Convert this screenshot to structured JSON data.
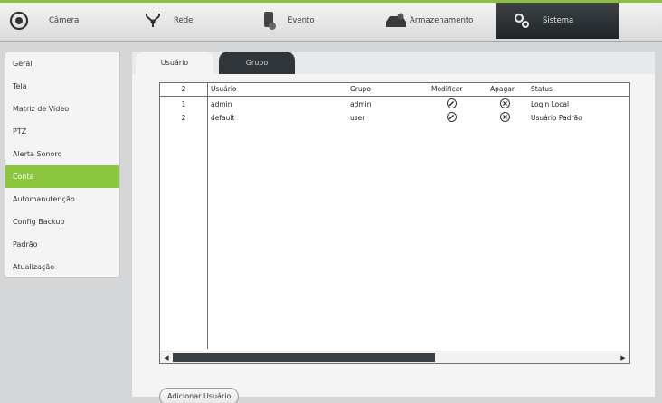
{
  "topnav": {
    "camera": "Câmera",
    "rede": "Rede",
    "evento": "Evento",
    "armazenamento": "Armazenamento",
    "sistema": "Sistema"
  },
  "sidebar": {
    "items": [
      {
        "label": "Geral"
      },
      {
        "label": "Tela"
      },
      {
        "label": "Matriz de Video"
      },
      {
        "label": "PTZ"
      },
      {
        "label": "Alerta Sonoro"
      },
      {
        "label": "Conta"
      },
      {
        "label": "Automanutenção"
      },
      {
        "label": "Config Backup"
      },
      {
        "label": "Padrão"
      },
      {
        "label": "Atualização"
      }
    ],
    "active": "Conta"
  },
  "tabs": [
    {
      "label": "Usuário"
    },
    {
      "label": "Grupo"
    }
  ],
  "table": {
    "count": "2",
    "headers": {
      "user": "Usuário",
      "grupo": "Grupo",
      "modificar": "Modificar",
      "apagar": "Apagar",
      "status": "Status"
    },
    "rows": [
      {
        "idx": "1",
        "user": "admin",
        "grupo": "admin",
        "status": "Login Local"
      },
      {
        "idx": "2",
        "user": "default",
        "grupo": "user",
        "status": "Usuário Padrão"
      }
    ]
  },
  "buttons": {
    "add_user": "Adicionar Usuário"
  },
  "colors": {
    "accent": "#8cc63f",
    "dark": "#2f3538"
  }
}
